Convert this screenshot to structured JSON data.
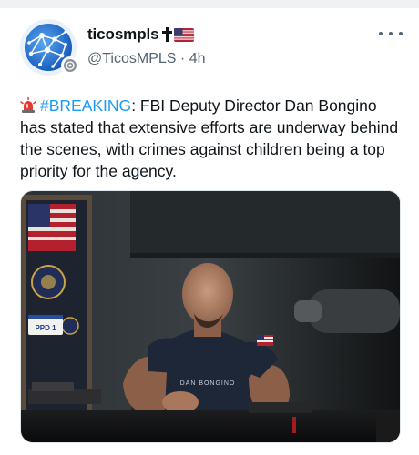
{
  "tweet": {
    "display_name": "ticosmpls",
    "name_emoji": "✝🇺🇸",
    "handle": "@TicosMPLS",
    "separator": "·",
    "time": "4h",
    "body_hashtag": "#BREAKING",
    "body_text": ": FBI Deputy Director Dan Bongino has stated that extensive efforts are underway behind the scenes, with crimes against children being a top priority for the agency."
  },
  "media": {
    "plate_text": "PPD 1",
    "shirt_text": "DAN BONGINO"
  },
  "colors": {
    "hashtag": "#1d9bf0",
    "secondary_text": "#536471",
    "primary_text": "#0f1419"
  },
  "icons": [
    "siren-icon",
    "more-icon",
    "verified-icon",
    "cross-icon",
    "us-flag-icon"
  ]
}
